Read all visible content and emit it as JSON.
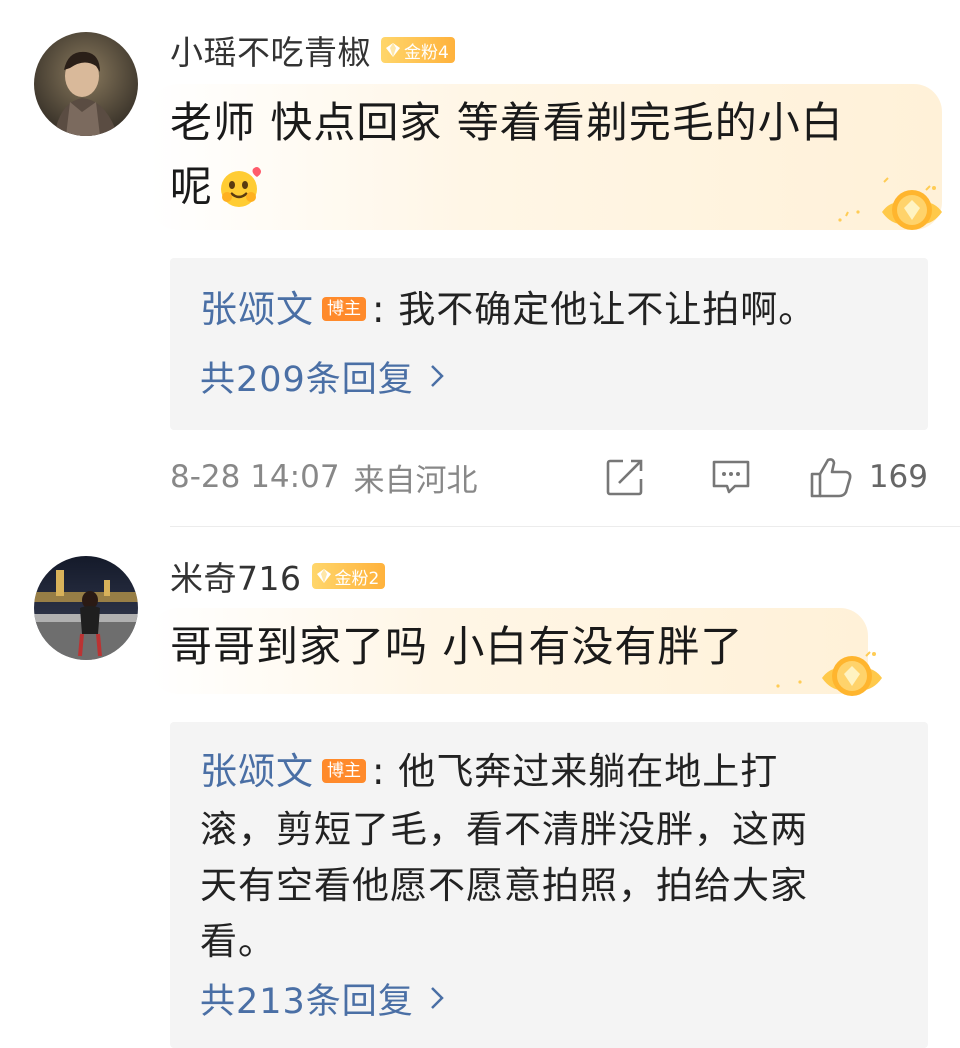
{
  "comments": [
    {
      "username": "小瑶不吃青椒",
      "fan_badge": "金粉4",
      "text_line1": "老师 快点回家 等着看剃完毛的小白",
      "text_line2": "呢",
      "emoji": "hug-emoji",
      "reply": {
        "author": "张颂文",
        "host_badge": "博主",
        "lines": [
          ": 我不确定他让不让拍啊。"
        ],
        "more": "共209条回复"
      },
      "time": "8-28 14:07",
      "location": "来自河北",
      "like_count": "169"
    },
    {
      "username": "米奇716",
      "fan_badge": "金粉2",
      "text_line1": "哥哥到家了吗 小白有没有胖了",
      "reply": {
        "author": "张颂文",
        "host_badge": "博主",
        "lines": [
          ": 他飞奔过来躺在地上打",
          "滚，剪短了毛，看不清胖没胖，这两",
          "天有空看他愿不愿意拍照，拍给大家",
          "看。"
        ],
        "more": "共213条回复"
      }
    }
  ],
  "icons": {
    "share": "share-icon",
    "comment": "comment-icon",
    "like": "thumbs-up-icon",
    "chevron": "chevron-right-icon",
    "medal": "gold-fan-medal-icon"
  },
  "colors": {
    "link": "#4a6fa5",
    "host_badge": "#ff8a2b",
    "fan_badge": "#ffb23c",
    "reply_bg": "#f4f4f4"
  }
}
